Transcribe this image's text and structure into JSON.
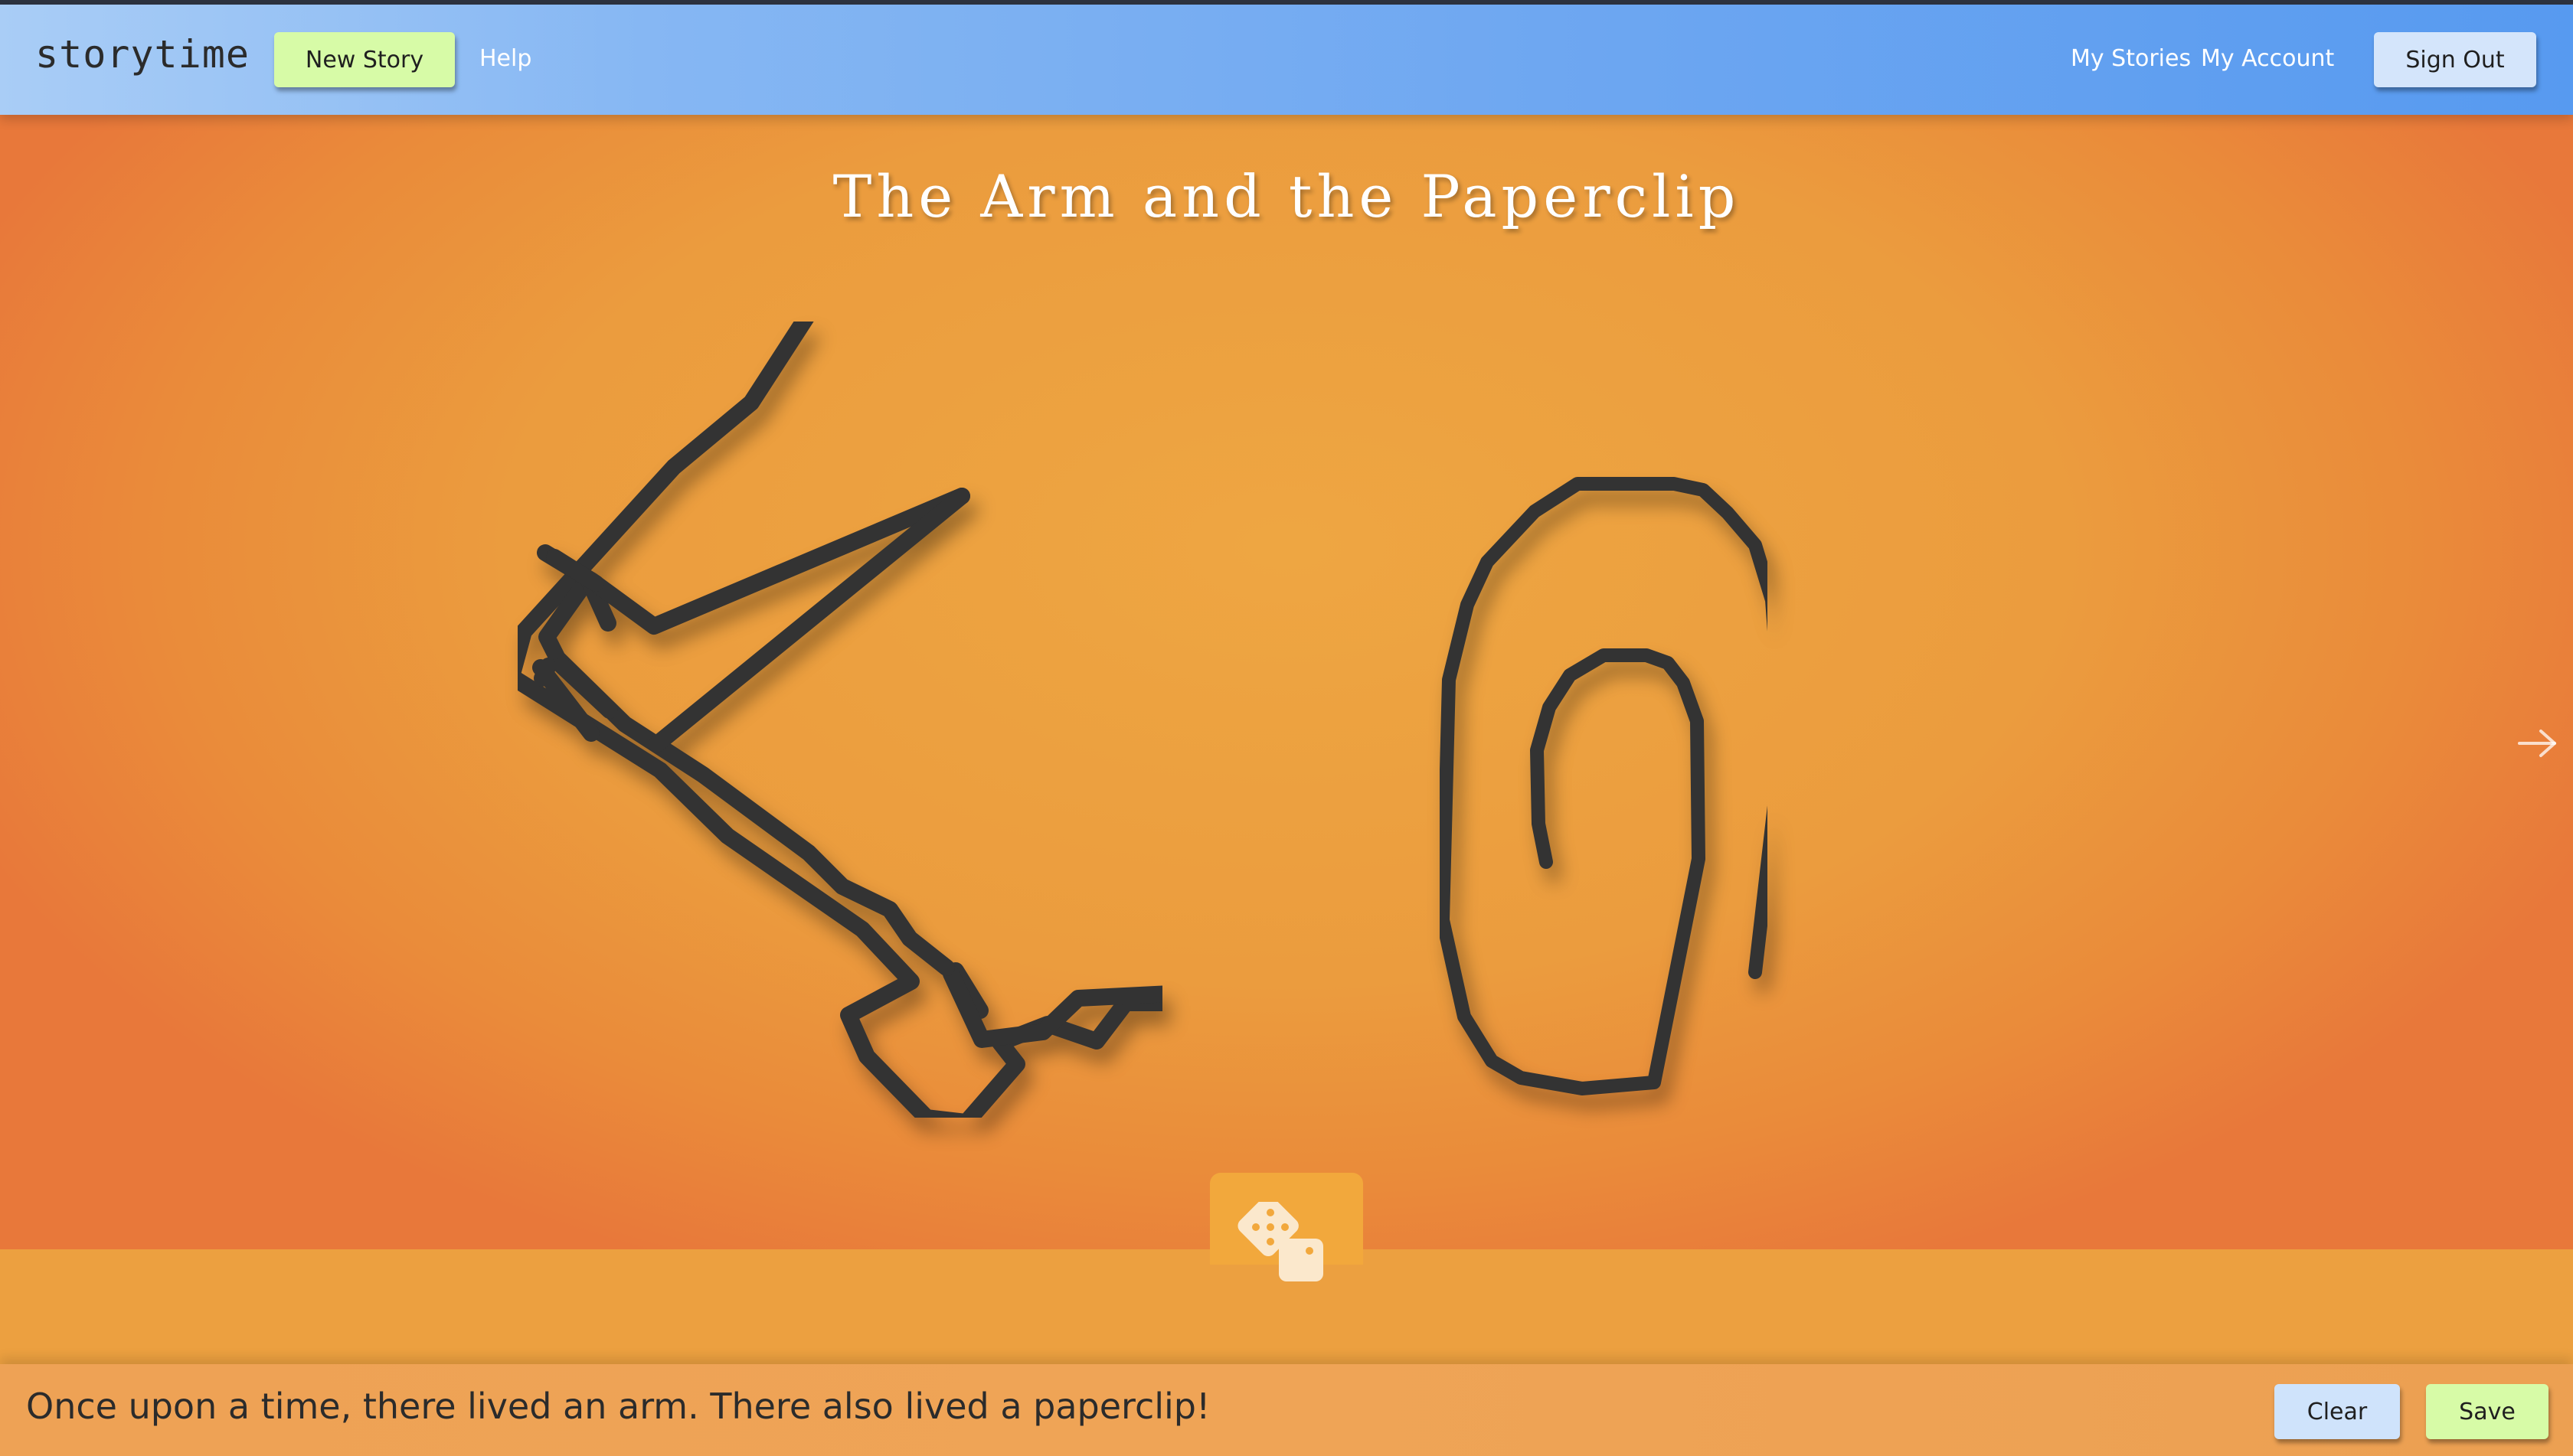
{
  "header": {
    "brand": "storytime",
    "new_story_label": "New Story",
    "help_label": "Help",
    "my_stories_label": "My Stories",
    "my_account_label": "My Account",
    "sign_out_label": "Sign Out"
  },
  "story": {
    "title": "The Arm and the Paperclip",
    "text": "Once upon a time, there lived an arm. There also lived a paperclip!",
    "drawings": [
      {
        "name": "arm",
        "icon": "arm-drawing"
      },
      {
        "name": "paperclip",
        "icon": "paperclip-drawing"
      }
    ]
  },
  "controls": {
    "next_icon": "arrow-right-icon",
    "random_icon": "dice-icon",
    "clear_label": "Clear",
    "save_label": "Save"
  },
  "colors": {
    "navbar_start": "#a9cdf6",
    "navbar_end": "#579af0",
    "stage_orange": "#eca040",
    "button_green": "#d7fba7",
    "button_blue": "#d4e5fb",
    "stroke": "#333333"
  }
}
